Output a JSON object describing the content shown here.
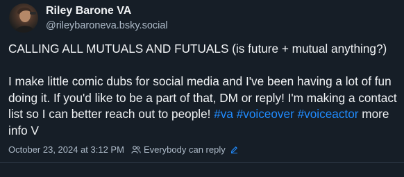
{
  "author": {
    "display_name": "Riley Barone VA",
    "handle": "@rileybaroneva.bsky.social"
  },
  "post": {
    "paragraph1": "CALLING ALL MUTUALS AND FUTUALS (is future + mutual anything?)",
    "paragraph2_text": "I make little comic dubs for social media and I've been having a lot of fun doing it. If you'd like to be a part of that, DM or reply! I'm making a contact list so I can better reach out to people! ",
    "hashtag1": "#va",
    "hashtag2": "#voiceover",
    "hashtag3": "#voiceactor",
    "trailing_text": "more info V"
  },
  "meta": {
    "timestamp": "October 23, 2024 at 3:12 PM",
    "reply_setting": "Everybody can reply"
  },
  "colors": {
    "background": "#161e27",
    "text": "#f1f3f5",
    "muted": "#aebbc9",
    "link": "#208bfe"
  },
  "icons": {
    "reply_setting": "people-icon",
    "edit": "pencil-icon"
  }
}
